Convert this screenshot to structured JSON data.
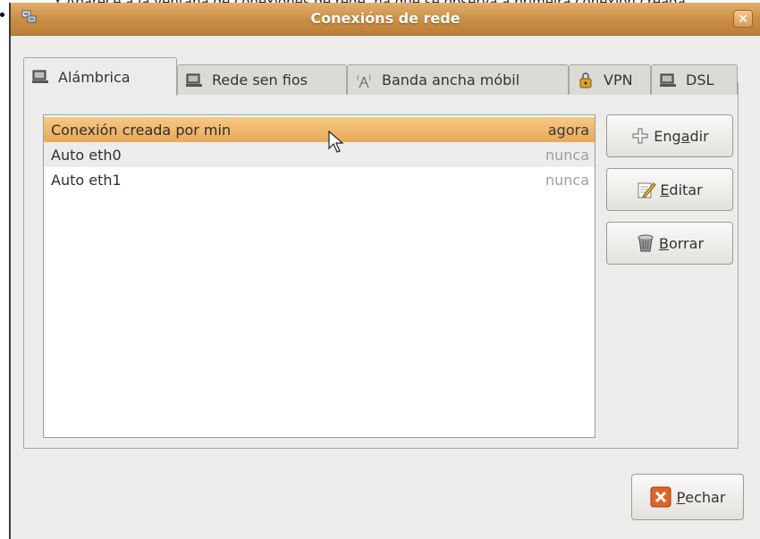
{
  "background_text": "Y   Aparece a la ventana de conexiones de rede, na que se observa a primeira conexión creada",
  "window": {
    "title": "Conexións de rede",
    "close_glyph": "×"
  },
  "tabs": [
    {
      "label": "Alámbrica",
      "icon": "wired-network-icon",
      "active": true
    },
    {
      "label": "Rede sen fios",
      "icon": "wireless-network-icon",
      "active": false
    },
    {
      "label": "Banda ancha móbil",
      "icon": "mobile-broadband-icon",
      "active": false
    },
    {
      "label": "VPN",
      "icon": "vpn-icon",
      "active": false
    },
    {
      "label": "DSL",
      "icon": "dsl-icon",
      "active": false
    }
  ],
  "connections": [
    {
      "name": "Conexión creada por min",
      "last_used": "agora",
      "selected": true
    },
    {
      "name": "Auto eth0",
      "last_used": "nunca",
      "selected": false
    },
    {
      "name": "Auto eth1",
      "last_used": "nunca",
      "selected": false
    }
  ],
  "buttons": {
    "add": {
      "pre": "Eng",
      "mnemonic": "a",
      "post": "dir",
      "icon": "plus-icon"
    },
    "edit": {
      "pre": "",
      "mnemonic": "E",
      "post": "ditar",
      "icon": "edit-icon"
    },
    "delete": {
      "pre": "",
      "mnemonic": "B",
      "post": "orrar",
      "icon": "trash-icon"
    },
    "close": {
      "pre": "",
      "mnemonic": "P",
      "post": "echar",
      "icon": "close-icon"
    }
  },
  "colors": {
    "titlebar": "#c98d44",
    "selection": "#efb66f",
    "close_icon": "#e2632a"
  }
}
